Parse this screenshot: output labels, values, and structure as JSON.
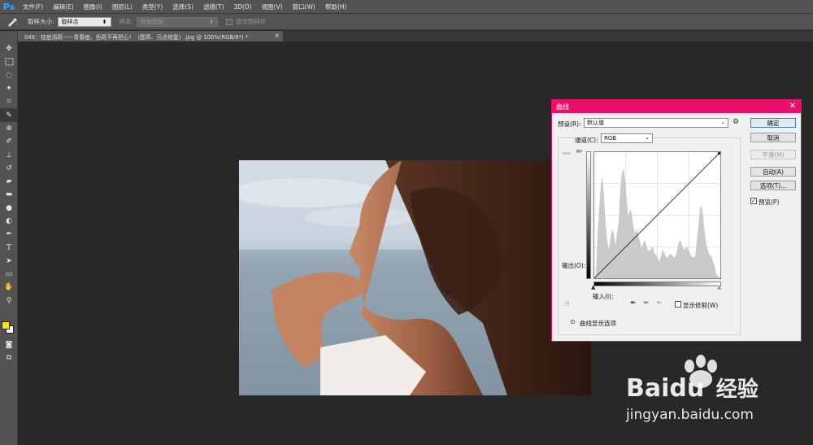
{
  "app": {
    "logo": "Ps"
  },
  "menu": [
    "文件(F)",
    "编辑(E)",
    "图像(I)",
    "图层(L)",
    "类型(Y)",
    "选择(S)",
    "滤镜(T)",
    "3D(D)",
    "视图(V)",
    "窗口(W)",
    "帮助(H)"
  ],
  "options": {
    "sample_size_label": "取样大小:",
    "sample_size_value": "取样点",
    "sample_label": "样本:",
    "sample_value": "所有图层",
    "show_ring_label": "显示取样环"
  },
  "document": {
    "tab_title": "049：祛痘消斑——青春痘、色斑不再担心！（图章、污点修复）.jpg @ 100%(RGB/8*) *"
  },
  "curves": {
    "title": "曲线",
    "preset_label": "预设(R):",
    "preset_value": "默认值",
    "channel_label": "通道(C):",
    "channel_value": "RGB",
    "output_label": "输出(O):",
    "input_label": "输入(I):",
    "show_clipping_label": "显示修剪(W)",
    "display_options_label": "曲线显示选项",
    "buttons": {
      "ok": "确定",
      "cancel": "取消",
      "smooth": "平滑(M)",
      "auto": "自动(A)",
      "options": "选项(T)..."
    },
    "preview_label": "预览(P)",
    "preview_checked": true
  },
  "watermark": {
    "brand": "Bai",
    "brand_end": "du",
    "sub": "经验",
    "url": "jingyan.baidu.com"
  },
  "colors": {
    "accent": "#e8106a",
    "foreground": "#ffe600",
    "background": "#ffffff"
  }
}
